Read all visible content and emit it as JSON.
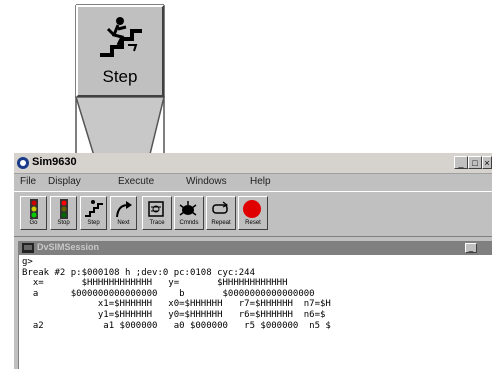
{
  "zoom": {
    "label": "Step",
    "icon": "step-icon"
  },
  "window": {
    "title": "Sim9630",
    "title_icon": "debugger-app-icon",
    "controls": {
      "minimize": "_",
      "maximize": "□",
      "close": "×"
    }
  },
  "menu": {
    "items": [
      "File",
      "Display",
      "Execute",
      "Windows",
      "Help"
    ]
  },
  "toolbar": {
    "buttons": [
      {
        "label": "Go",
        "icon": "traffic-light-go-icon"
      },
      {
        "label": "Stop",
        "icon": "traffic-light-stop-icon"
      },
      {
        "label": "Step",
        "icon": "step-icon"
      },
      {
        "label": "Next",
        "icon": "next-arrow-icon"
      },
      {
        "label": "Trace",
        "icon": "trace-icon"
      },
      {
        "label": "Cmnds",
        "icon": "bug-icon"
      },
      {
        "label": "Repeat",
        "icon": "repeat-icon"
      },
      {
        "label": "Reset",
        "icon": "reset-icon"
      }
    ]
  },
  "session": {
    "title": "DvSIMSession",
    "lines": [
      "g>",
      "Break #2 p:$000108 h ;dev:0 pc:0108 cyc:244",
      "  x=       $HHHHHHHHHHHH   y=       $HHHHHHHHHHHH",
      "  a      $000000000000000    b       $0000000000000000",
      "              x1=$HHHHHH   x0=$HHHHHH   r7=$HHHHHH  n7=$H",
      "              y1=$HHHHHH   y0=$HHHHHH   r6=$HHHHHH  n6=$",
      "  a2           a1 $000000   a0 $000000   r5 $000000  n5 $"
    ]
  }
}
